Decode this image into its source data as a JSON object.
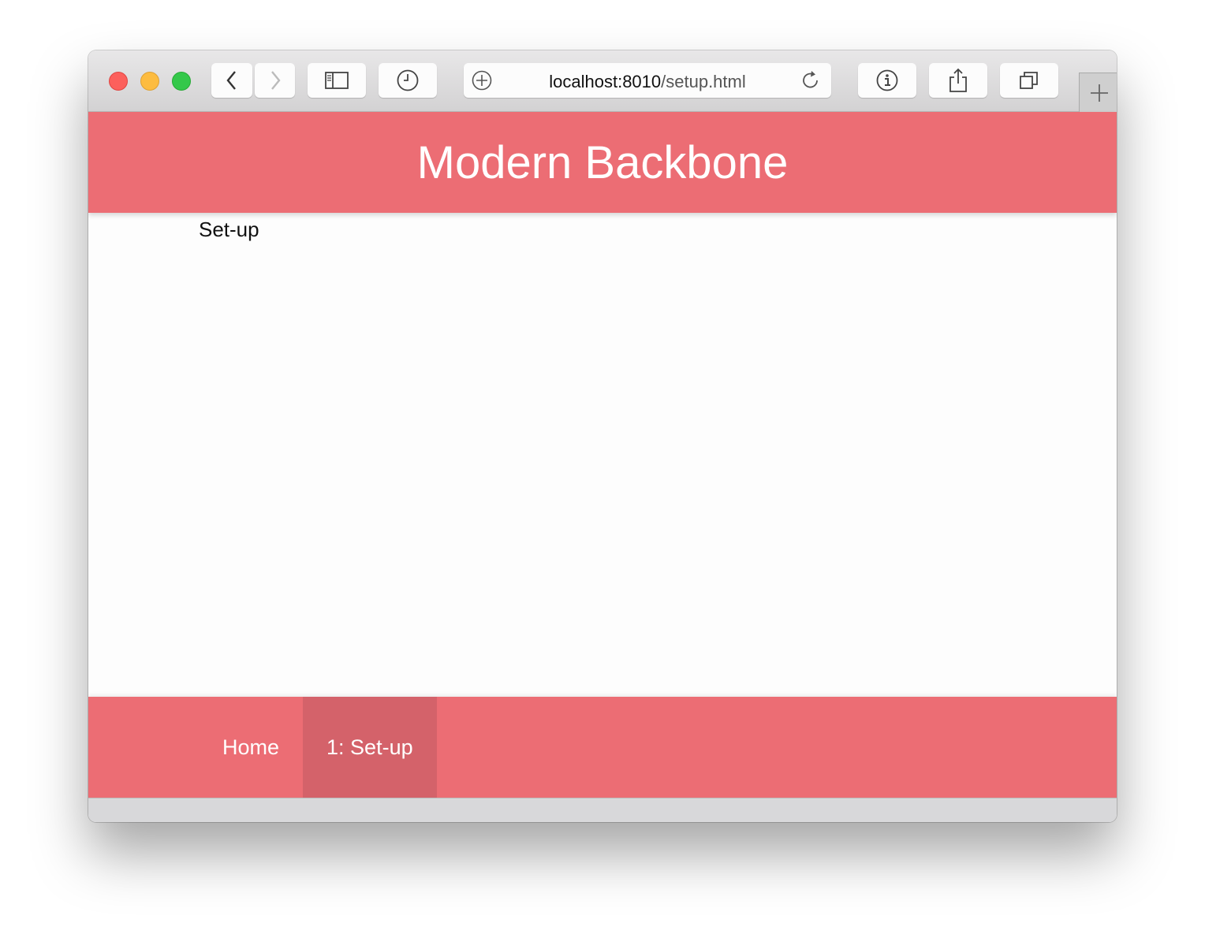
{
  "browser": {
    "url_host": "localhost:8010",
    "url_path": "/setup.html"
  },
  "header": {
    "title": "Modern Backbone"
  },
  "main": {
    "section_label": "Set-up"
  },
  "footer_nav": {
    "items": [
      {
        "label": "Home"
      },
      {
        "label": "1: Set-up"
      }
    ]
  },
  "colors": {
    "accent": "#ec6d74",
    "accent_active": "#d4626a"
  }
}
